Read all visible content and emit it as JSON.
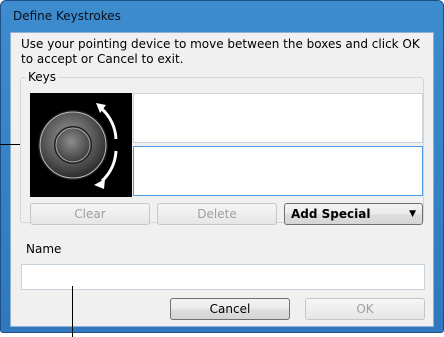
{
  "window": {
    "title": "Define Keystrokes"
  },
  "instructions": "Use your pointing device to move between the boxes and click OK to accept or Cancel to exit.",
  "keys_group": {
    "label": "Keys"
  },
  "buttons": {
    "clear": "Clear",
    "delete": "Delete",
    "add_special": "Add Special",
    "cancel": "Cancel",
    "ok": "OK"
  },
  "name_field": {
    "label": "Name",
    "value": ""
  },
  "colors": {
    "titlebar": "#3d8ccf",
    "focus_border": "#4d9ae2",
    "disabled_text": "#a0a0a0"
  },
  "icons": [
    "touch-ring-icon",
    "chevron-down-icon"
  ]
}
